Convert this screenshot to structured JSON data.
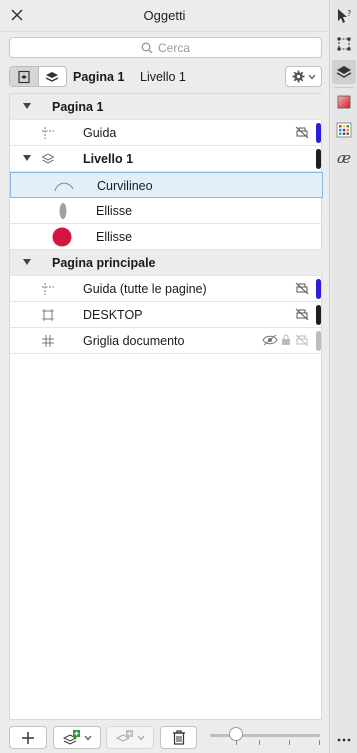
{
  "panel": {
    "title": "Oggetti",
    "close_icon": "close-icon"
  },
  "search": {
    "placeholder": "Cerca"
  },
  "toolbar": {
    "current_page": "Pagina 1",
    "current_layer": "Livello 1"
  },
  "tree": {
    "rows": [
      {
        "label": "Pagina 1",
        "kind": "page-group"
      },
      {
        "label": "Guida",
        "kind": "guide",
        "color": "#2a1fd6"
      },
      {
        "label": "Livello 1",
        "kind": "layer",
        "color": "#1e1e1e"
      },
      {
        "label": "Curvilineo",
        "kind": "curve",
        "selected": true
      },
      {
        "label": "Ellisse",
        "kind": "ellipse-gray"
      },
      {
        "label": "Ellisse",
        "kind": "ellipse-red",
        "fill": "#d3163f"
      },
      {
        "label": "Pagina principale",
        "kind": "page-group"
      },
      {
        "label": "Guida (tutte le pagine)",
        "kind": "guide",
        "color": "#2a1fd6"
      },
      {
        "label": "DESKTOP",
        "kind": "desktop",
        "color": "#1e1e1e"
      },
      {
        "label": "Griglia documento",
        "kind": "grid",
        "color": "#bdbdbd"
      }
    ]
  },
  "colors": {
    "guide": "#2a1fd6",
    "layer": "#1e1e1e",
    "grid": "#bdbdbd",
    "ellipse_red": "#d3163f",
    "selection": "#e3eefb"
  },
  "sidebar": {
    "icons": [
      "hint-icon",
      "transform-icon",
      "objects-icon",
      "fill-icon",
      "color-grid-icon",
      "glyphs-icon",
      "more-icon"
    ],
    "glyph_label": "æ"
  }
}
